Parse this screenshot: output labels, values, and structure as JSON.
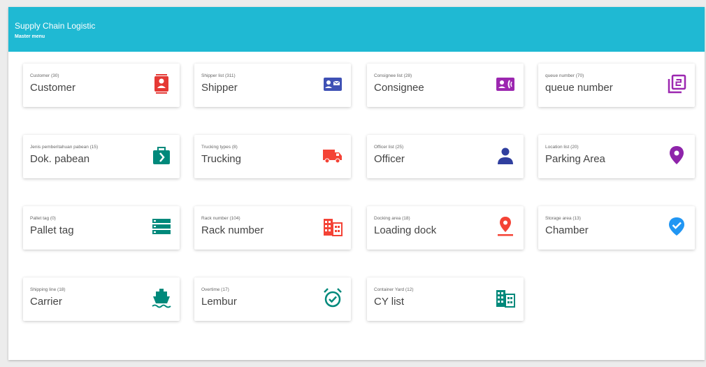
{
  "header": {
    "title": "Supply Chain Logistic",
    "subtitle": "Master menu",
    "color": "#1fb9d3"
  },
  "cards": [
    {
      "small": "Customer (30)",
      "big": "Customer",
      "icon": "customer-icon",
      "color": "#e53935"
    },
    {
      "small": "Shipper list (311)",
      "big": "Shipper",
      "icon": "contact-card-icon",
      "color": "#3f51b5"
    },
    {
      "small": "Consignee list (28)",
      "big": "Consignee",
      "icon": "contact-phone-icon",
      "color": "#9c27b0"
    },
    {
      "small": "queue number (70)",
      "big": "queue number",
      "icon": "filter-2-icon",
      "color": "#9c27b0"
    },
    {
      "small": "Jenis pemberitahuan pabean (15)",
      "big": "Dok. pabean",
      "icon": "briefcase-arrow-icon",
      "color": "#00897b"
    },
    {
      "small": "Trucking types (8)",
      "big": "Trucking",
      "icon": "truck-icon",
      "color": "#f44336"
    },
    {
      "small": "Officer list (25)",
      "big": "Officer",
      "icon": "person-icon",
      "color": "#303f9f"
    },
    {
      "small": "Location list (20)",
      "big": "Parking Area",
      "icon": "location-pin-icon",
      "color": "#8e24aa"
    },
    {
      "small": "Pallet tag (0)",
      "big": "Pallet tag",
      "icon": "storage-list-icon",
      "color": "#00897b"
    },
    {
      "small": "Rack number (104)",
      "big": "Rack number",
      "icon": "building-icon",
      "color": "#f44336"
    },
    {
      "small": "Docking area (18)",
      "big": "Loading dock",
      "icon": "pin-drop-icon",
      "color": "#f44336"
    },
    {
      "small": "Storage area (13)",
      "big": "Chamber",
      "icon": "check-pin-icon",
      "color": "#2196f3"
    },
    {
      "small": "Shipping line (18)",
      "big": "Carrier",
      "icon": "ship-icon",
      "color": "#00897b"
    },
    {
      "small": "Overtime (17)",
      "big": "Lembur",
      "icon": "alarm-check-icon",
      "color": "#00897b"
    },
    {
      "small": "Container Yard (12)",
      "big": "CY list",
      "icon": "building-icon",
      "color": "#00897b"
    }
  ]
}
